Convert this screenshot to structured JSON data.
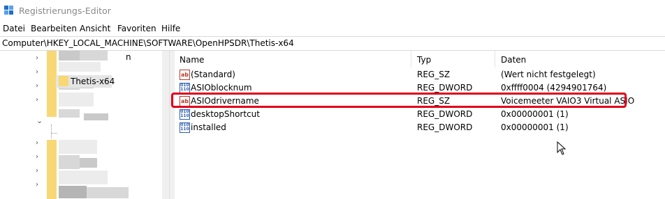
{
  "window": {
    "title": "Registrierungs-Editor",
    "app_icon": "regedit-icon"
  },
  "menu": [
    {
      "label": "Datei"
    },
    {
      "label": "Bearbeiten"
    },
    {
      "label": "Ansicht"
    },
    {
      "label": "Favoriten"
    },
    {
      "label": "Hilfe"
    }
  ],
  "address": {
    "path": "Computer\\HKEY_LOCAL_MACHINE\\SOFTWARE\\OpenHPSDR\\Thetis-x64"
  },
  "tree": {
    "selected_label": "Thetis-x64",
    "partial_label": "n"
  },
  "list": {
    "columns": {
      "name": "Name",
      "type": "Typ",
      "data": "Daten"
    },
    "rows": [
      {
        "icon": "string-value-icon",
        "name": "(Standard)",
        "type": "REG_SZ",
        "data": "(Wert nicht festgelegt)"
      },
      {
        "icon": "dword-value-icon",
        "name": "ASIOblocknum",
        "type": "REG_DWORD",
        "data": "0xffff0004 (4294901764)"
      },
      {
        "icon": "string-value-icon",
        "name": "ASIOdrivername",
        "type": "REG_SZ",
        "data": "Voicemeeter VAIO3 Virtual ASIO"
      },
      {
        "icon": "dword-value-icon",
        "name": "desktopShortcut",
        "type": "REG_DWORD",
        "data": "0x00000001 (1)"
      },
      {
        "icon": "dword-value-icon",
        "name": "installed",
        "type": "REG_DWORD",
        "data": "0x00000001 (1)"
      }
    ]
  },
  "colors": {
    "highlight": "#e0001b",
    "folder": "#f8d775"
  }
}
